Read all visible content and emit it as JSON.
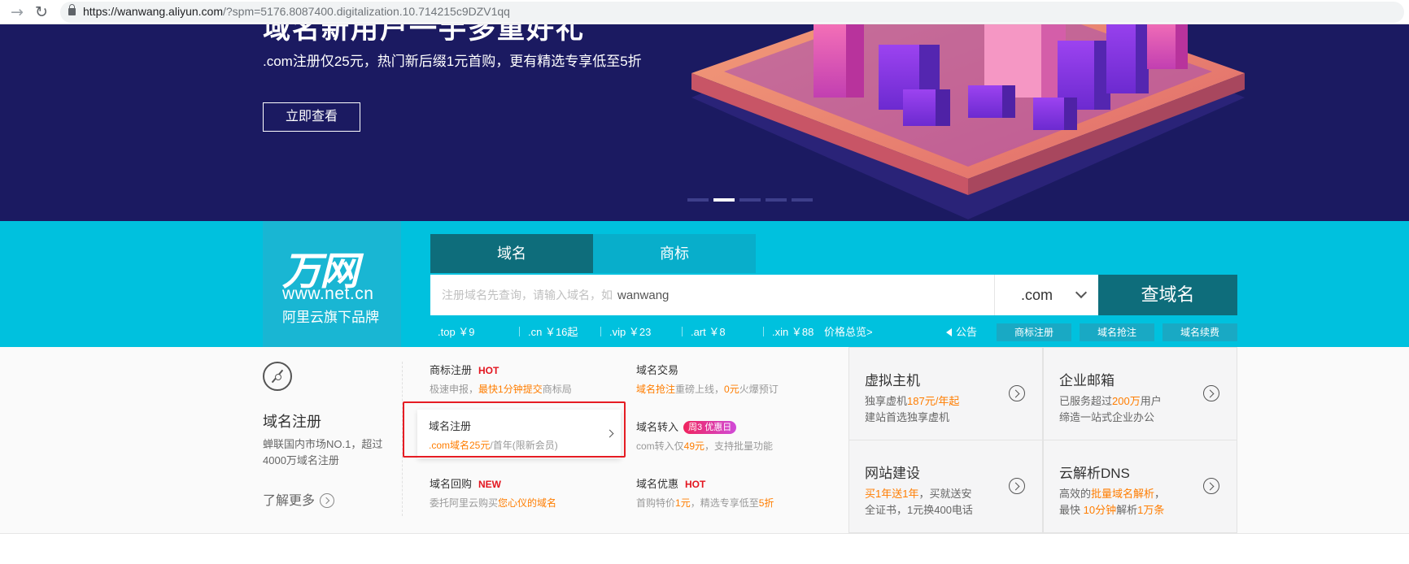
{
  "browser": {
    "url_host": "https://wanwang.aliyun.com",
    "url_rest": "/?spm=5176.8087400.digitalization.10.714215c9DZV1qq"
  },
  "banner": {
    "title_partial": "域名新用户一手多重好礼",
    "subtitle": ".com注册仅25元，热门新后缀1元首购，更有精选专享低至5折",
    "cta": "立即查看",
    "slides": 5,
    "active_slide": 2
  },
  "brand": {
    "logo": "万网",
    "url": "www.net.cn",
    "tagline": "阿里云旗下品牌"
  },
  "search": {
    "tabs": [
      "域名",
      "商标"
    ],
    "active_tab": 0,
    "placeholder": "注册域名先查询，请输入域名，如",
    "example": "wanwang",
    "suffix": ".com",
    "button": "查域名"
  },
  "prices": [
    ".top ￥9",
    ".cn ￥16起",
    ".vip ￥23",
    ".art ￥8",
    ".xin ￥88"
  ],
  "price_all": "价格总览>",
  "notice": "公告",
  "quick_links": [
    "商标注册",
    "域名抢注",
    "域名续费"
  ],
  "lower": {
    "title": "域名注册",
    "desc": "蝉联国内市场NO.1，超过4000万域名注册",
    "more": "了解更多",
    "services": [
      {
        "title": "商标注册",
        "badge": "HOT",
        "desc_a": "极速申报，",
        "desc_b": "最快1分钟提交",
        "desc_c": "商标局"
      },
      {
        "title": "域名交易",
        "desc_a": "",
        "desc_b": "域名抢注",
        "desc_c": "重磅上线，",
        "desc_d": "0元",
        "desc_e": "火爆预订"
      },
      {
        "title": "域名注册",
        "desc_a": ".com域名25元",
        "desc_b": "/首年(限新会员)"
      },
      {
        "title": "域名转入",
        "badge": "周3 优惠日",
        "desc_a": "com转入仅",
        "desc_b": "49元",
        "desc_c": "，支持批量功能"
      },
      {
        "title": "域名回购",
        "badge": "NEW",
        "desc_a": "委托阿里云购买",
        "desc_b": "您心仪的域名"
      },
      {
        "title": "域名优惠",
        "badge": "HOT",
        "desc_a": "首购特价",
        "desc_b": "1元",
        "desc_c": "，精选专享低至",
        "desc_d": "5折"
      }
    ],
    "grid": [
      {
        "title": "虚拟主机",
        "l1a": "独享虚机",
        "l1b": "187元/年起",
        "l2": "建站首选独享虚机"
      },
      {
        "title": "企业邮箱",
        "l1a": "已服务超过",
        "l1b": "200万",
        "l1c": "用户",
        "l2": "缔造一站式企业办公"
      },
      {
        "title": "网站建设",
        "l1a": "买1年送1年",
        "l1b": "，买就送安",
        "l2": "全证书，1元换400电话"
      },
      {
        "title": "云解析DNS",
        "l1a": "高效的",
        "l1b": "批量域名解析",
        "l1c": "，",
        "l2a": "最快 ",
        "l2b": "10分钟",
        "l2c": "解析",
        "l2d": "1万条"
      }
    ]
  },
  "colors": {
    "banner_bg": "#1b1a61",
    "strip_bg": "#00c1de",
    "dark_teal": "#0e6d7b",
    "orange": "#ff7d00",
    "hot_red": "#e3151f"
  }
}
